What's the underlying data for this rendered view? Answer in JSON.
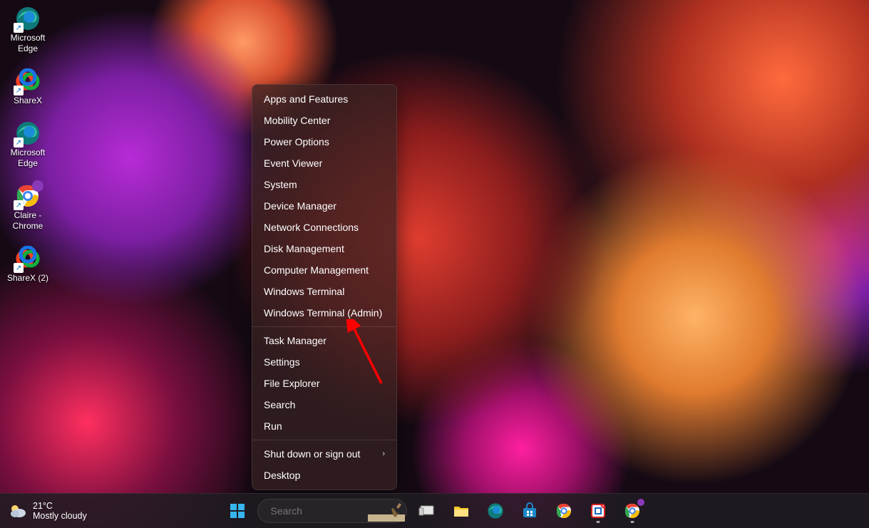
{
  "desktop": {
    "icons": [
      {
        "label": "Microsoft Edge",
        "icon": "edge-icon"
      },
      {
        "label": "ShareX",
        "icon": "sharex-icon"
      },
      {
        "label": "Microsoft Edge",
        "icon": "edge-icon"
      },
      {
        "label": "Claire - Chrome",
        "icon": "chrome-profile-icon"
      },
      {
        "label": "ShareX (2)",
        "icon": "sharex-icon"
      }
    ]
  },
  "context_menu": {
    "groups": [
      [
        "Apps and Features",
        "Mobility Center",
        "Power Options",
        "Event Viewer",
        "System",
        "Device Manager",
        "Network Connections",
        "Disk Management",
        "Computer Management",
        "Windows Terminal",
        "Windows Terminal (Admin)"
      ],
      [
        "Task Manager",
        "Settings",
        "File Explorer",
        "Search",
        "Run"
      ],
      [
        "Shut down or sign out",
        "Desktop"
      ]
    ],
    "submenu_item": "Shut down or sign out",
    "arrow_target": "Windows Terminal (Admin)"
  },
  "taskbar": {
    "weather": {
      "temp": "21°C",
      "desc": "Mostly cloudy"
    },
    "search_placeholder": "Search",
    "pinned": [
      {
        "name": "task-view",
        "icon": "task-view-icon"
      },
      {
        "name": "file-explorer",
        "icon": "file-explorer-icon"
      },
      {
        "name": "microsoft-edge",
        "icon": "edge-icon"
      },
      {
        "name": "microsoft-store",
        "icon": "store-icon"
      },
      {
        "name": "google-chrome",
        "icon": "chrome-icon"
      },
      {
        "name": "snipping-tool",
        "icon": "snipping-icon"
      },
      {
        "name": "chrome-profile",
        "icon": "chrome-profile-icon"
      }
    ]
  },
  "colors": {
    "menu_bg": "rgba(55,35,35,0.72)",
    "taskbar_bg": "rgba(32,28,34,0.85)",
    "accent_arrow": "#ff0000"
  }
}
